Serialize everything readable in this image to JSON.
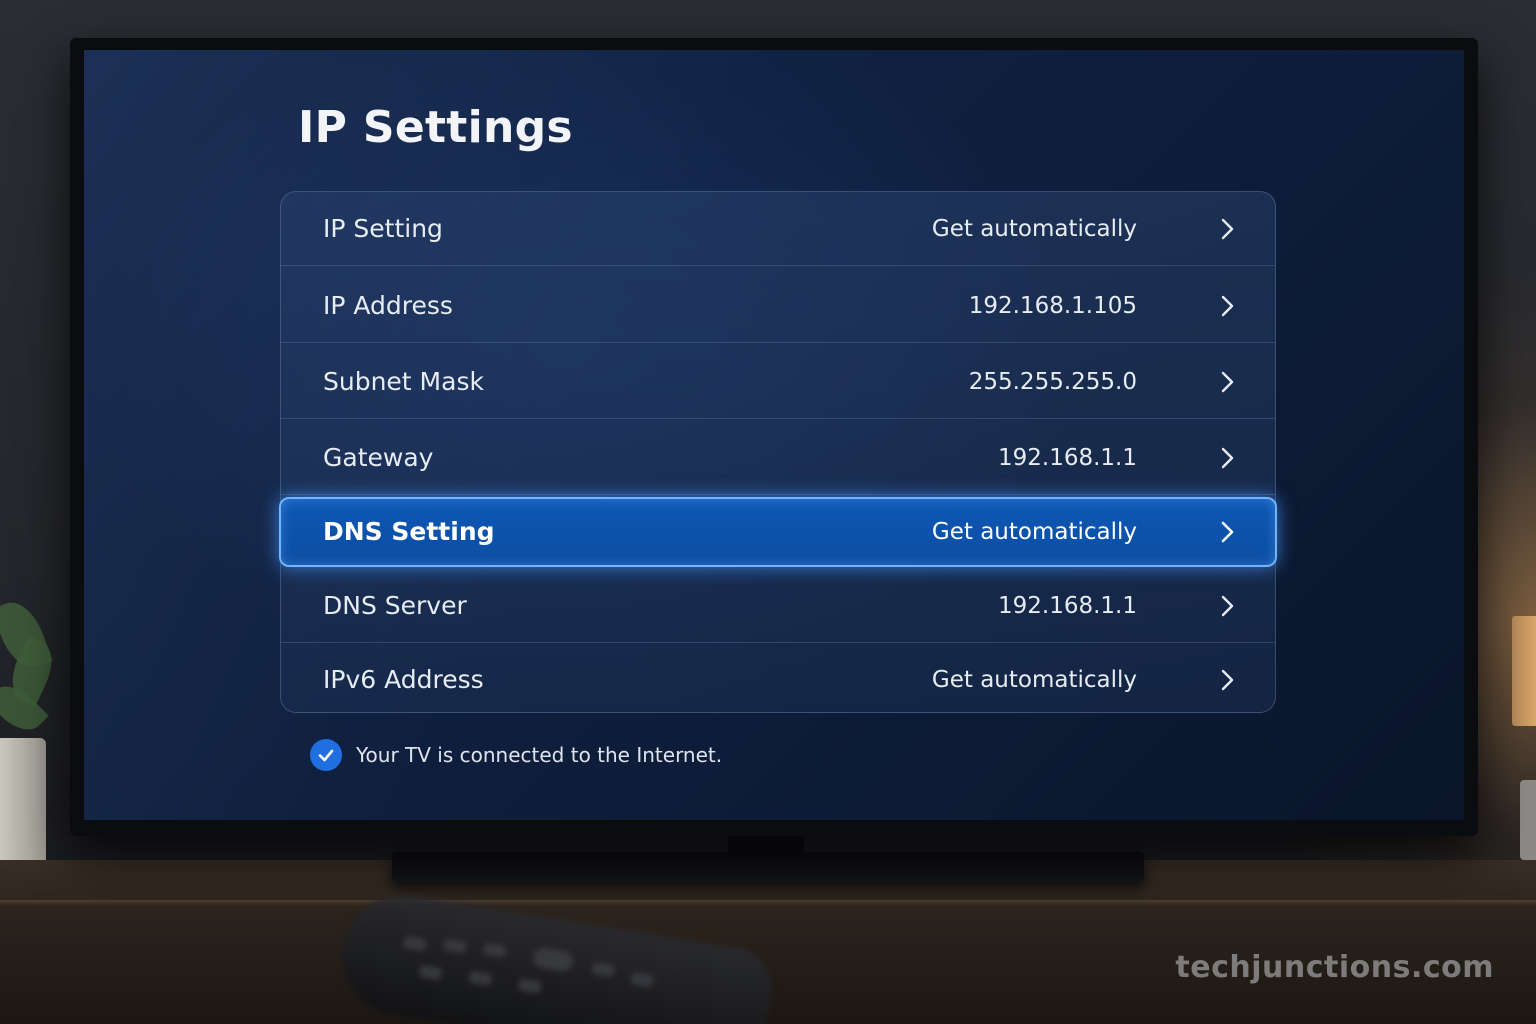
{
  "page": {
    "title": "IP Settings"
  },
  "settings": {
    "rows": [
      {
        "label": "IP Setting",
        "value": "Get automatically"
      },
      {
        "label": "IP Address",
        "value": "192.168.1.105"
      },
      {
        "label": "Subnet Mask",
        "value": "255.255.255.0"
      },
      {
        "label": "Gateway",
        "value": "192.168.1.1"
      },
      {
        "label": "DNS Setting",
        "value": "Get automatically",
        "selected": true
      },
      {
        "label": "DNS Server",
        "value": "192.168.1.1"
      },
      {
        "label": "IPv6 Address",
        "value": "Get automatically"
      }
    ],
    "selected_index": 4
  },
  "status": {
    "text": "Your TV is connected to the Internet.",
    "icon": "checkmark-icon"
  },
  "watermark": {
    "text": "techjunctions.com"
  },
  "colors": {
    "accent": "#1f6fe0",
    "selected_border": "#6fb4ff",
    "selected_fill": "#0f58b4",
    "screen_bg": "#0f2040"
  }
}
